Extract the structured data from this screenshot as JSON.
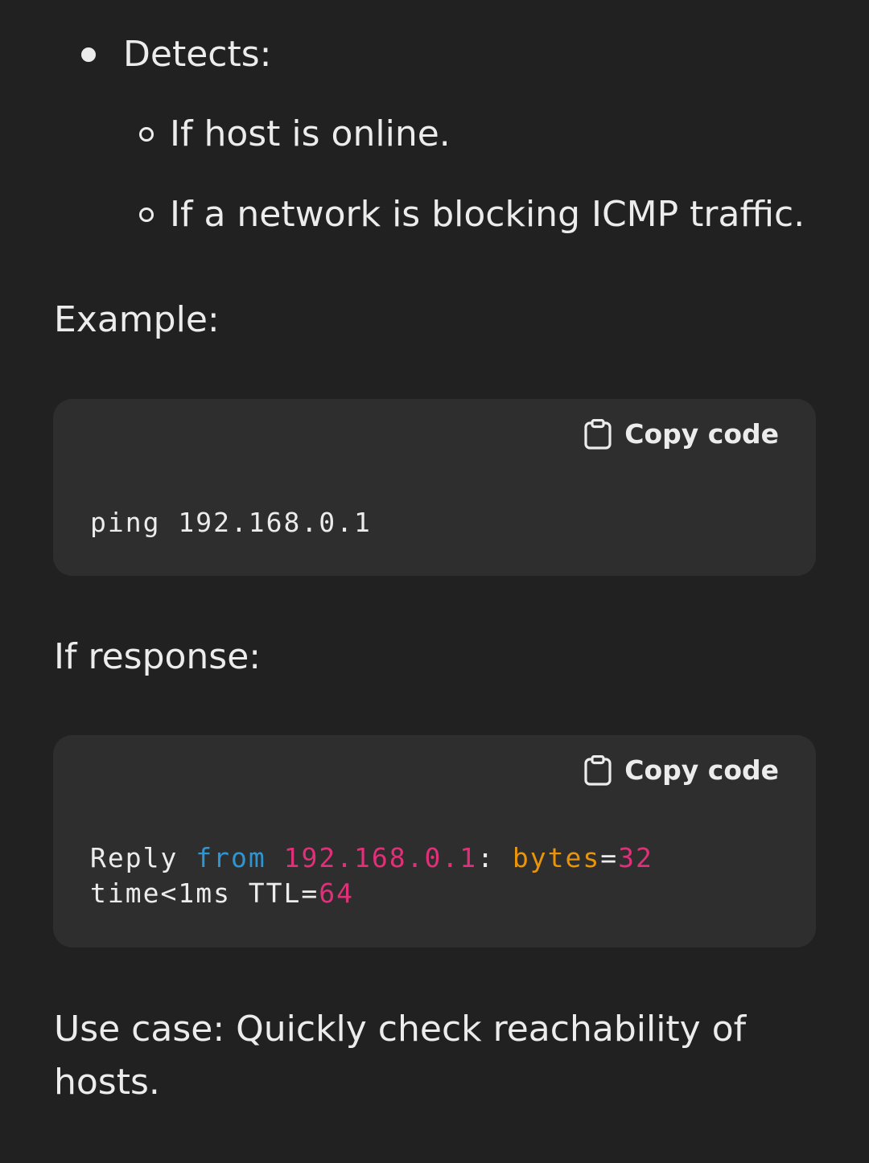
{
  "bullets": {
    "top": "Detects:",
    "sub": [
      "If host is online.",
      "If a network is blocking ICMP traffic."
    ]
  },
  "example_label": "Example:",
  "code1": {
    "copy_label": "Copy code",
    "line": "ping 192.168.0.1"
  },
  "response_label": "If response:",
  "code2": {
    "copy_label": "Copy code",
    "tokens": {
      "reply": "Reply",
      "from": "from",
      "ip": "192.168.0.1",
      "colon": ":",
      "bytes": "bytes",
      "eq1": "=",
      "bytes_val": "32",
      "time": "time<1ms TTL",
      "eq2": "=",
      "ttl_val": "64"
    }
  },
  "use_case": {
    "line1": "Use case: Quickly check reachability of",
    "line2": "hosts."
  },
  "colors": {
    "background": "#212121",
    "code_background": "#2e2e2e",
    "text": "#ececec",
    "keyword": "#2e95d3",
    "number": "#df3079",
    "attribute": "#e9950c"
  }
}
